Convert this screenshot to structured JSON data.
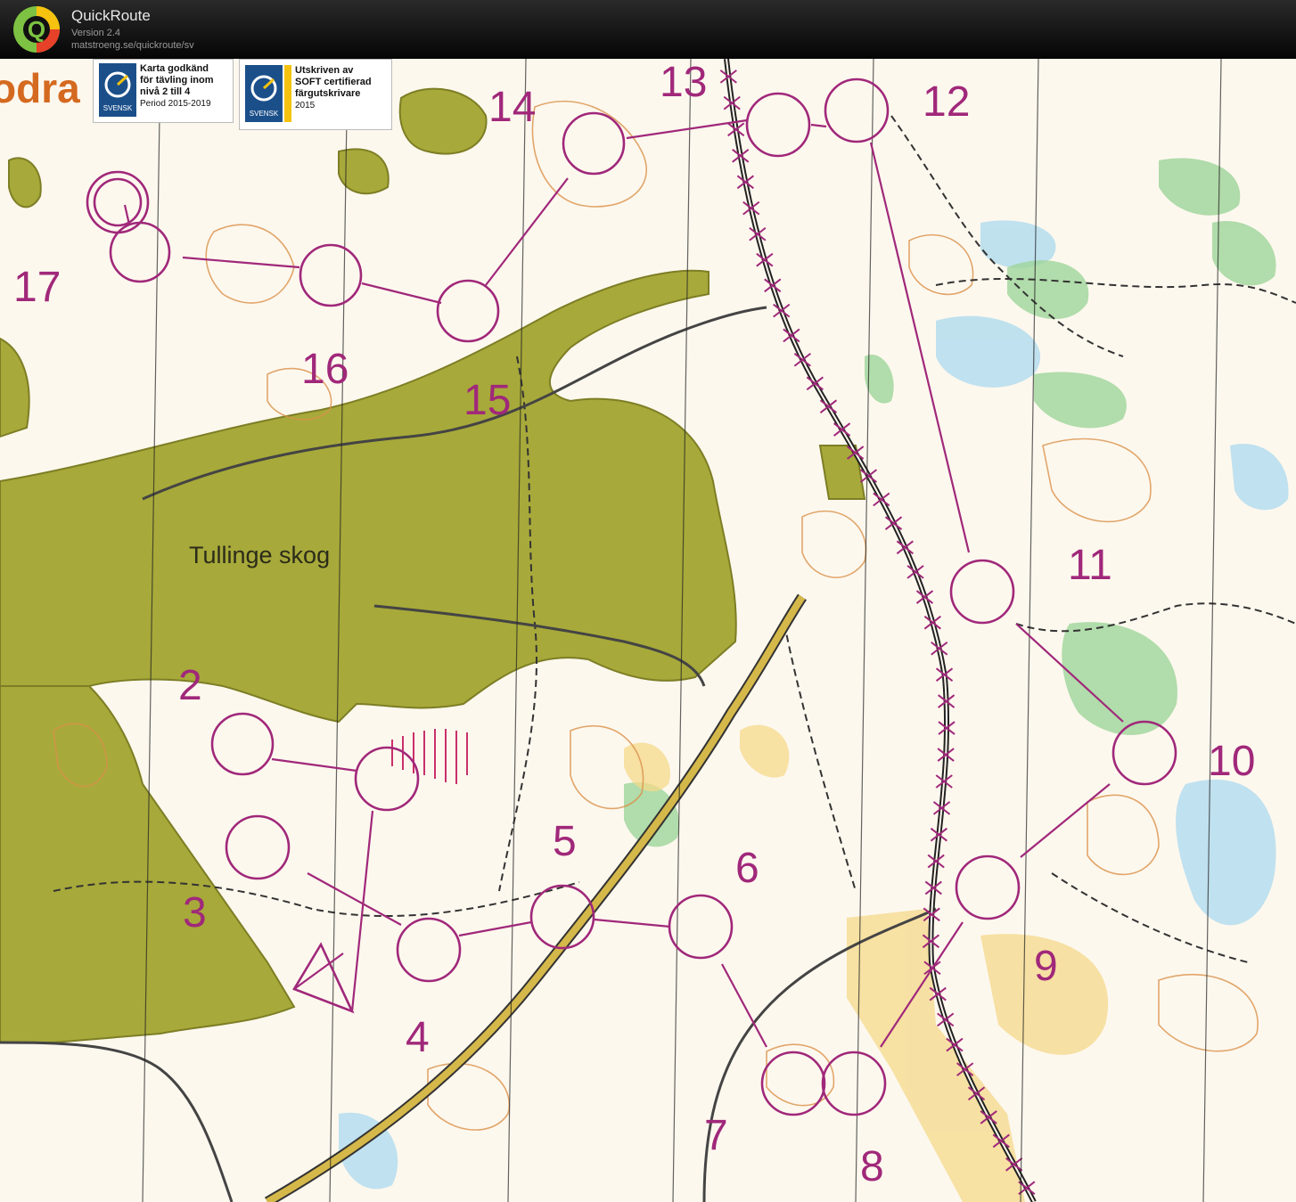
{
  "app": {
    "title": "QuickRoute",
    "version": "Version 2.4",
    "url": "matstroeng.se/quickroute/sv",
    "logo_letter": "Q"
  },
  "map": {
    "title_fragment": "odra",
    "place_name": "Tullinge skog",
    "badge1": {
      "line1": "Karta godkänd",
      "line2": "för tävling inom",
      "line3": "nivå 2 till 4",
      "line4": "Period 2015-2019",
      "logo_text": "SVENSK"
    },
    "badge2": {
      "line1": "Utskriven av",
      "line2": "SOFT certifierad",
      "line3": "färgutskrivare",
      "line4": "2015",
      "logo_text": "SVENSK"
    },
    "colors": {
      "course": "#a0287a",
      "urban": "#a7a93a",
      "contour": "#d9914a",
      "water": "#a8d8ec",
      "green": "#8cc98a",
      "paper": "#fdf8ee",
      "yellow": "#f2d47a"
    },
    "controls": [
      {
        "label": "2"
      },
      {
        "label": "3"
      },
      {
        "label": "4"
      },
      {
        "label": "5"
      },
      {
        "label": "6"
      },
      {
        "label": "7"
      },
      {
        "label": "8"
      },
      {
        "label": "9"
      },
      {
        "label": "10"
      },
      {
        "label": "11"
      },
      {
        "label": "12"
      },
      {
        "label": "13"
      },
      {
        "label": "14"
      },
      {
        "label": "15"
      },
      {
        "label": "16"
      },
      {
        "label": "17"
      }
    ]
  }
}
